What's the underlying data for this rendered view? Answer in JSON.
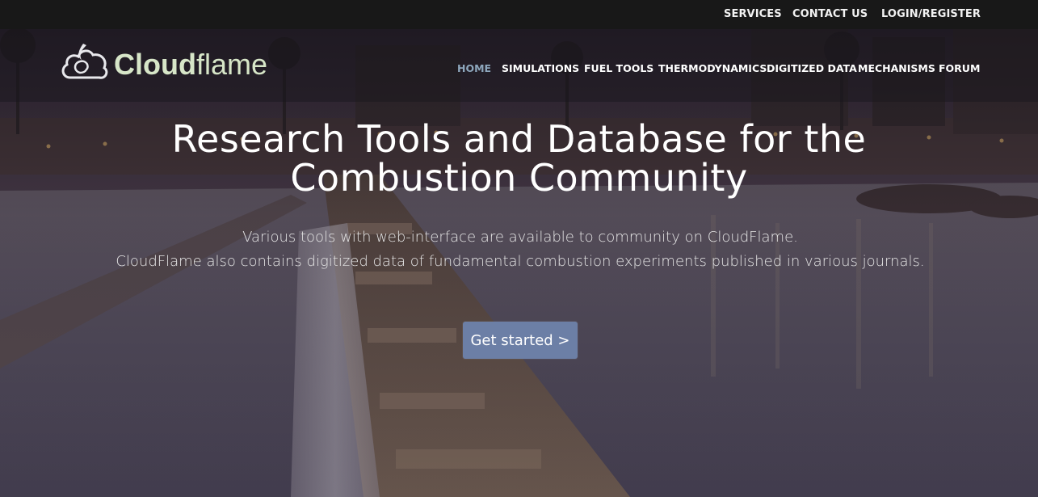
{
  "topbar": {
    "links": [
      "SERVICES",
      "CONTACT US",
      "LOGIN/REGISTER"
    ]
  },
  "brand": {
    "bold": "Cloud",
    "light": "flame",
    "color": "#d7e6c8"
  },
  "nav": {
    "items": [
      "HOME",
      "SIMULATIONS",
      "FUEL TOOLS",
      "THERMODYNAMICS",
      "DIGITIZED DATA",
      "MECHANISMS",
      "FORUM"
    ],
    "active": "HOME",
    "active_color": "#8ea7bd"
  },
  "hero": {
    "title": "Research Tools and Database for the Combustion Community",
    "subtitle_line1": "Various tools with web-interface are available to community on CloudFlame.",
    "subtitle_line2": "CloudFlame also contains digitized data of fundamental combustion experiments published in various journals.",
    "cta_label": "Get started >",
    "cta_color": "#6c7fa6"
  },
  "icons": {
    "logo": "cloud-flame-logo-icon"
  }
}
